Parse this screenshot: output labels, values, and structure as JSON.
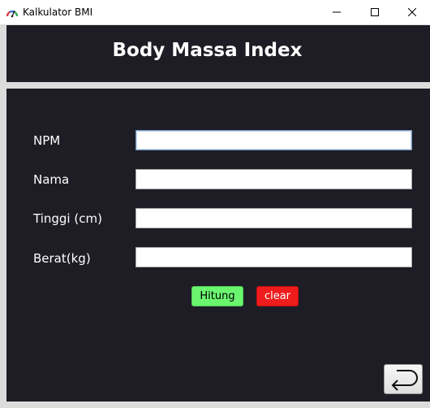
{
  "window": {
    "title": "Kalkulator BMI"
  },
  "header": {
    "title": "Body Massa Index"
  },
  "form": {
    "npm": {
      "label": "NPM",
      "value": ""
    },
    "nama": {
      "label": "Nama",
      "value": ""
    },
    "tinggi": {
      "label": "Tinggi (cm)",
      "value": ""
    },
    "berat": {
      "label": "Berat(kg)",
      "value": ""
    }
  },
  "buttons": {
    "hitung": "Hitung",
    "clear": "clear",
    "back_icon": "return-arrow-icon"
  },
  "colors": {
    "panel": "#1e1d26",
    "hitung_bg": "#6bf56f",
    "clear_bg": "#ee1c1c"
  }
}
